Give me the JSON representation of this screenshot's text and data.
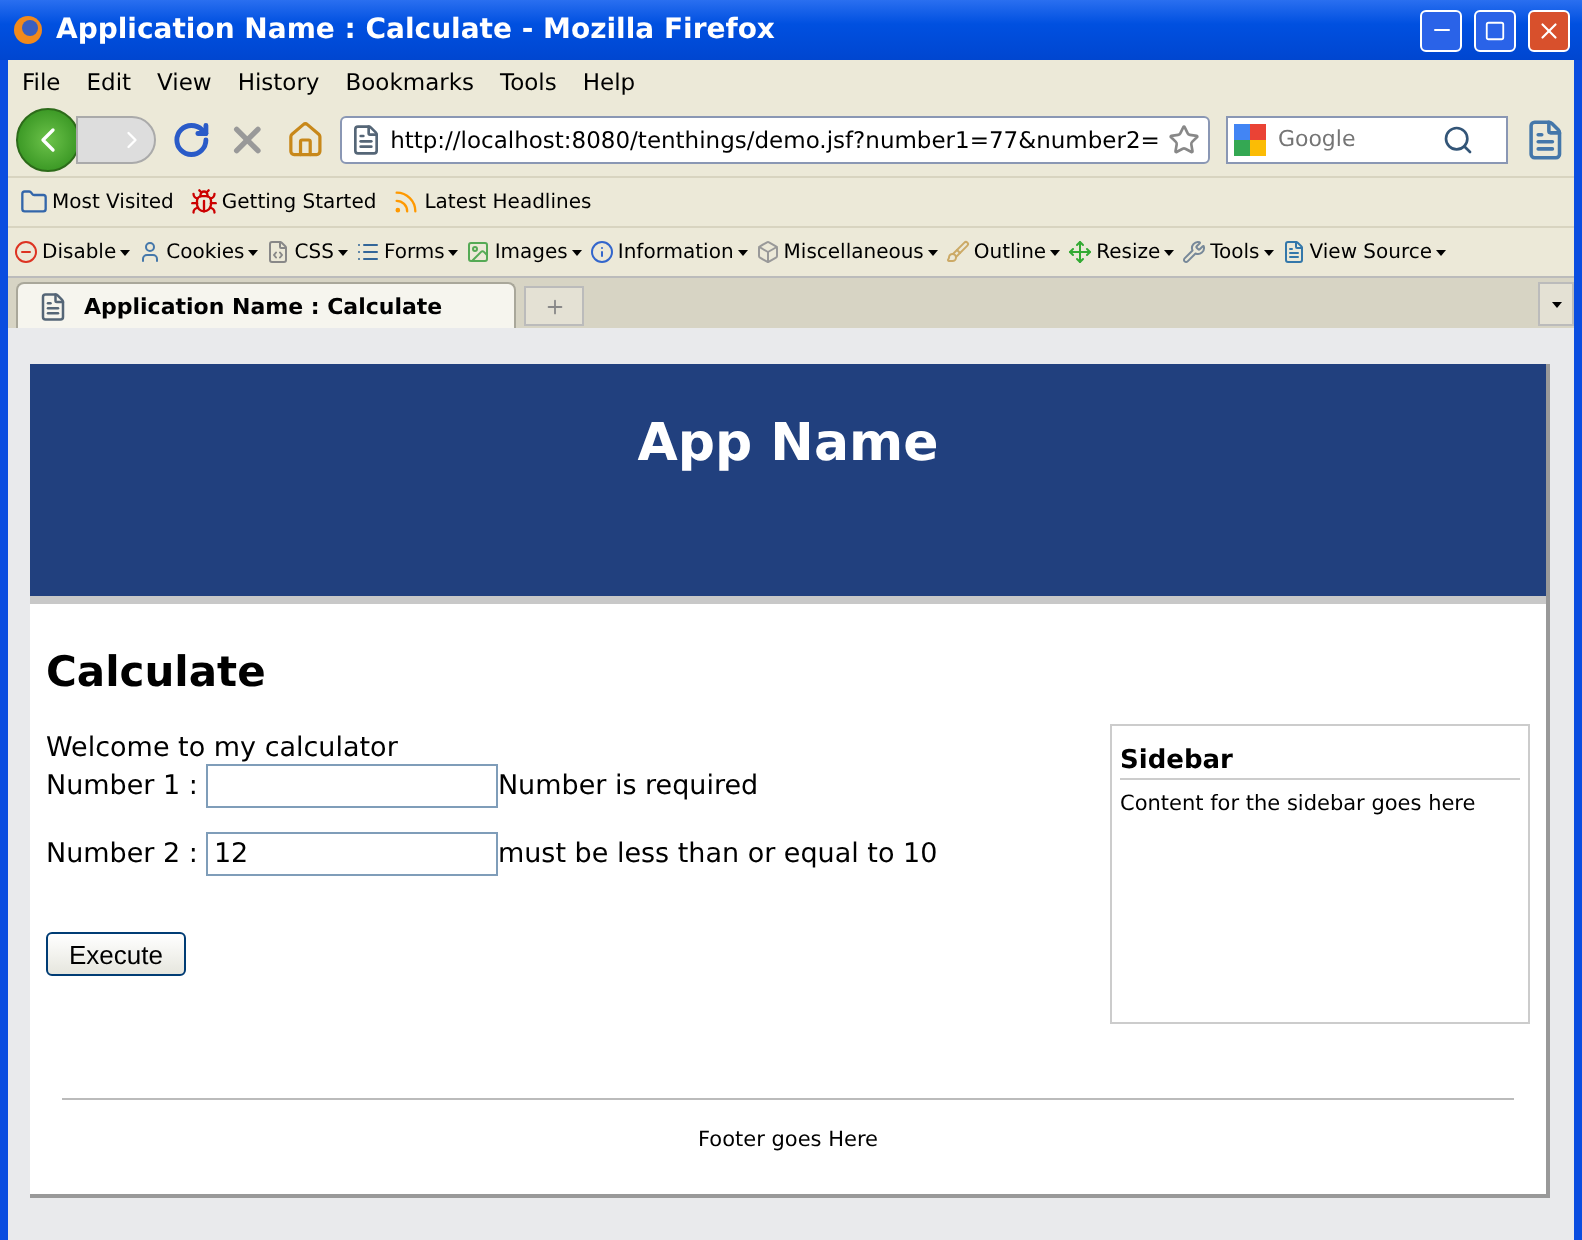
{
  "window": {
    "title": "Application Name : Calculate - Mozilla Firefox"
  },
  "menu": [
    "File",
    "Edit",
    "View",
    "History",
    "Bookmarks",
    "Tools",
    "Help"
  ],
  "navigation": {
    "url": "http://localhost:8080/tenthings/demo.jsf?number1=77&number2=",
    "search_placeholder": "Google"
  },
  "bookmarks": [
    {
      "label": "Most Visited",
      "kind": "folder"
    },
    {
      "label": "Getting Started",
      "kind": "bug"
    },
    {
      "label": "Latest Headlines",
      "kind": "feed"
    }
  ],
  "dev_toolbar": [
    {
      "label": "Disable",
      "kind": "disable"
    },
    {
      "label": "Cookies",
      "kind": "cookies"
    },
    {
      "label": "CSS",
      "kind": "css"
    },
    {
      "label": "Forms",
      "kind": "forms"
    },
    {
      "label": "Images",
      "kind": "images"
    },
    {
      "label": "Information",
      "kind": "info"
    },
    {
      "label": "Miscellaneous",
      "kind": "misc"
    },
    {
      "label": "Outline",
      "kind": "outline"
    },
    {
      "label": "Resize",
      "kind": "resize"
    },
    {
      "label": "Tools",
      "kind": "tools"
    },
    {
      "label": "View Source",
      "kind": "source"
    }
  ],
  "tabs": [
    {
      "label": "Application Name : Calculate",
      "selected": true
    }
  ],
  "page": {
    "app_name": "App Name",
    "heading": "Calculate",
    "welcome": "Welcome to my calculator",
    "fields": [
      {
        "label": "Number 1 :",
        "message": "Number is required"
      },
      {
        "label": "Number 2 :",
        "value": "12",
        "message": "must be less than or equal to 10"
      }
    ],
    "button": "Execute",
    "sidebar": {
      "title": "Sidebar",
      "text": "Content for the sidebar goes here"
    },
    "footer": "Footer goes Here"
  }
}
